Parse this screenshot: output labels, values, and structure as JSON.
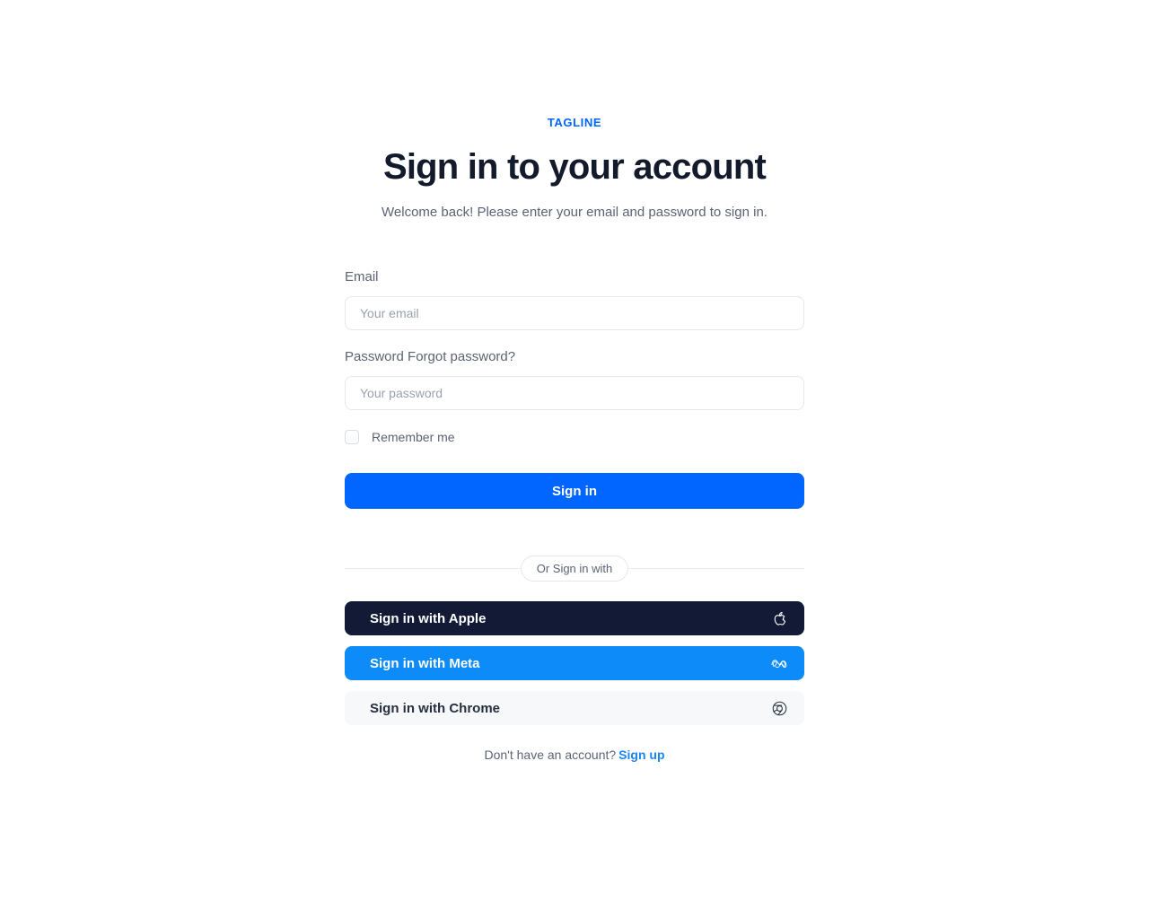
{
  "header": {
    "tagline": "TAGLINE",
    "title": "Sign in to your account",
    "subtitle": "Welcome back! Please enter your email and password to sign in."
  },
  "form": {
    "email": {
      "label": "Email",
      "placeholder": "Your email",
      "value": ""
    },
    "password": {
      "label": "Password",
      "forgot_label": "Forgot password?",
      "placeholder": "Your password",
      "value": ""
    },
    "remember": {
      "label": "Remember me",
      "checked": false
    },
    "submit_label": "Sign in"
  },
  "divider": {
    "label": "Or Sign in with"
  },
  "social": [
    {
      "label": "Sign in with Apple",
      "icon": "apple-icon",
      "bg": "#121a36",
      "fg": "#ffffff"
    },
    {
      "label": "Sign in with Meta",
      "icon": "meta-icon",
      "bg": "#0d8bf9",
      "fg": "#ffffff"
    },
    {
      "label": "Sign in with Chrome",
      "icon": "chrome-icon",
      "bg": "#f7f8fa",
      "fg": "#272f3f"
    }
  ],
  "footer": {
    "prompt": "Don't have an account?",
    "signup_label": "Sign up"
  },
  "colors": {
    "accent": "#0066ff",
    "link": "#1a85f5",
    "text_dark": "#131a2b",
    "text_muted": "#5c6373",
    "placeholder": "#9aa1b0",
    "border": "#e6e8ec"
  }
}
